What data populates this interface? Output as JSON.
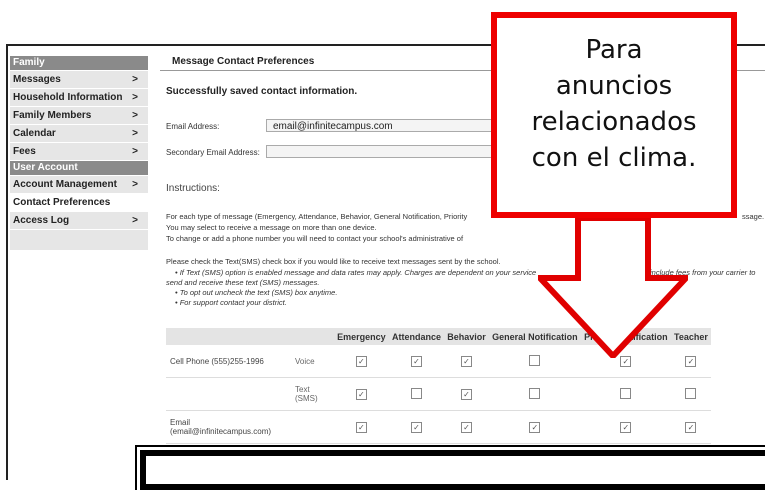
{
  "sidebar": {
    "header_family": "Family",
    "header_user": "User Account",
    "items_family": [
      {
        "label": "Messages",
        "chevron": ">"
      },
      {
        "label": "Household Information",
        "chevron": ">"
      },
      {
        "label": "Family Members",
        "chevron": ">"
      },
      {
        "label": "Calendar",
        "chevron": ">"
      },
      {
        "label": "Fees",
        "chevron": ">"
      }
    ],
    "items_user": [
      {
        "label": "Account Management",
        "chevron": ">"
      },
      {
        "label": "Contact Preferences",
        "chevron": ""
      },
      {
        "label": "Access Log",
        "chevron": ">"
      }
    ]
  },
  "main": {
    "title": "Message Contact Preferences",
    "success": "Successfully saved contact information.",
    "email_label": "Email Address:",
    "email_value": "email@infinitecampus.com",
    "secondary_email_label": "Secondary Email Address:",
    "secondary_email_value": "",
    "instructions_heading": "Instructions:",
    "instr_line1": "For each type of message (Emergency, Attendance, Behavior, General Notification, Priority",
    "instr_line1_tail": "ssage.",
    "instr_line2": "You may select to receive a message on more than one device.",
    "instr_line3": "To change or add a phone number you will need to contact your school's administrative of",
    "sms_line": "Please check the Text(SMS) check box if you would like to receive text messages sent by the school.",
    "bullet1": "If Text (SMS) option is enabled message and data rates may apply. Charges are dependent on your service",
    "bullet1_tail": "include fees from your carrier to",
    "bullet1_cont": "send and receive these text (SMS) messages.",
    "bullet2": "To opt out uncheck the text (SMS) box anytime.",
    "bullet3": "For support contact your district."
  },
  "table": {
    "columns": [
      "Emergency",
      "Attendance",
      "Behavior",
      "General Notification",
      "Priority Notification",
      "Teacher"
    ],
    "rows": [
      {
        "device": "Cell Phone (555)255-1996",
        "mode": "Voice",
        "checks": [
          true,
          true,
          true,
          false,
          true,
          true
        ]
      },
      {
        "device": "",
        "mode": "Text (SMS)",
        "checks": [
          true,
          false,
          true,
          false,
          false,
          false
        ]
      },
      {
        "device": "Email (email@infinitecampus.com)",
        "mode": "",
        "checks": [
          true,
          true,
          true,
          true,
          true,
          true
        ]
      }
    ]
  },
  "callout": {
    "lines": [
      "Para",
      "anuncios",
      "relacionados",
      "con el clima."
    ],
    "color": "#e00000"
  }
}
